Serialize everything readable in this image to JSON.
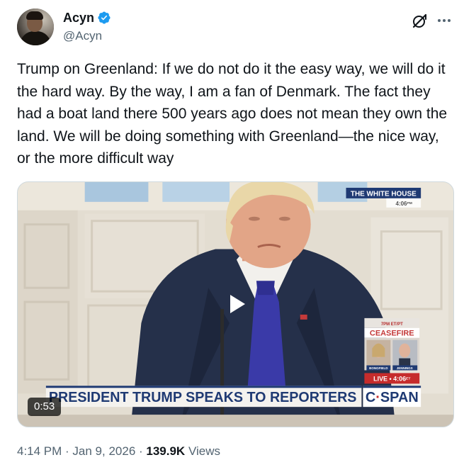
{
  "author": {
    "display_name": "Acyn",
    "handle": "@Acyn",
    "verified": true,
    "verified_color": "#1d9bf0"
  },
  "header_actions": {
    "grok_icon": "grok-icon",
    "more_icon": "more-icon"
  },
  "tweet": {
    "text": "Trump on Greenland: If we do not do it the easy way, we will do it the hard way. By the way, I am a fan of Denmark. The fact they had a boat land there 500 years ago does not mean they own the land. We will be doing something with Greenland—the nice way, or the more difficult way"
  },
  "video": {
    "duration": "0:53",
    "overlay": {
      "network_bug": "THE WHITE HOUSE",
      "bug_time": "4:06",
      "bug_time_suffix": "PM",
      "lower_third": "PRESIDENT TRUMP SPEAKS TO REPORTERS",
      "network_logo_c": "C",
      "network_logo_span": "SPAN",
      "live_label": "LIVE",
      "live_time": "4:06",
      "live_tz": "ET",
      "promo_time": "7PM ET/PT",
      "promo_title": "CEASEFIRE",
      "promo_name_left": "BONGFIELD",
      "promo_name_right": "JENNINGS"
    }
  },
  "meta": {
    "time": "4:14 PM",
    "separator": " · ",
    "date": "Jan 9, 2026",
    "views_count": "139.9K",
    "views_label": "Views"
  }
}
